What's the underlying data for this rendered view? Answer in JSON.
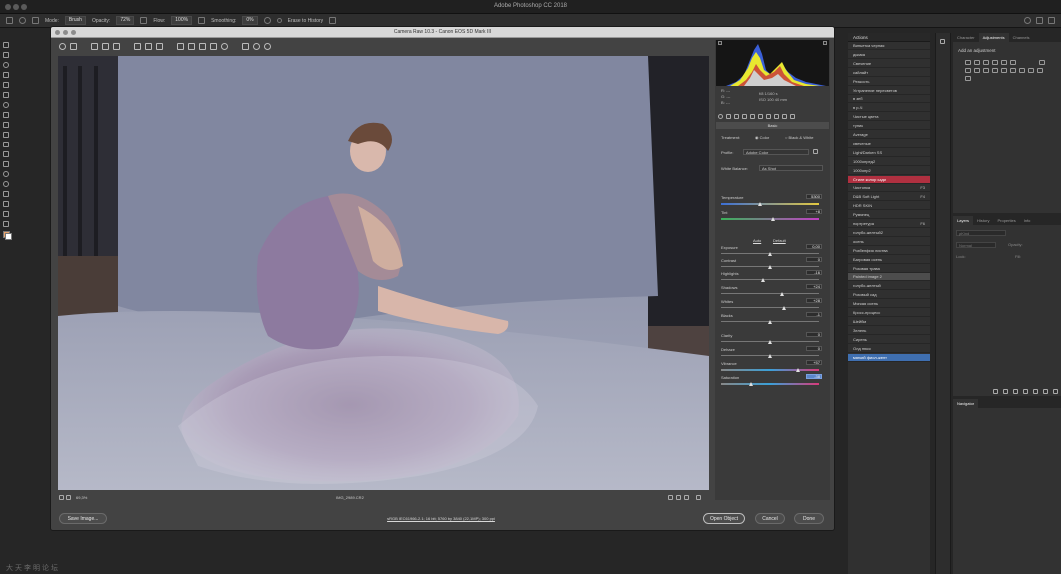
{
  "app": {
    "title": "Adobe Photoshop CC 2018"
  },
  "options_bar": {
    "mode_label": "Mode:",
    "mode_value": "Brush",
    "opacity_label": "Opacity:",
    "opacity_value": "72%",
    "flow_label": "Flow:",
    "flow_value": "100%",
    "smoothing_label": "Smoothing:",
    "smoothing_value": "0%",
    "erase_history_label": "Erase to History"
  },
  "dialog": {
    "title": "Camera Raw 10.3  -  Canon EOS 5D Mark III",
    "zoom_value": "69,3%",
    "filename": "IMG_2989.CR2",
    "workflow_info": "sRGB IEC61966-2.1; 16 bit; 5760 by 3840 (22,1MP); 300 ppi",
    "buttons": {
      "save": "Save Image...",
      "open": "Open Object",
      "cancel": "Cancel",
      "done": "Done"
    }
  },
  "histogram_readout": {
    "r_label": "R:",
    "g_label": "G:",
    "b_label": "B:",
    "dash": "---",
    "line1": "f/8   1/160 s",
    "line2": "ISO 100   40 mm"
  },
  "basic": {
    "section_title": "Basic",
    "treatment_label": "Treatment:",
    "treatment_color": "Color",
    "treatment_bw": "Black & White",
    "profile_label": "Profile:",
    "profile_value": "Adobe Color",
    "wb_label": "White Balance:",
    "wb_value": "As Shot",
    "auto_label": "Auto",
    "default_label": "Default",
    "sliders": [
      {
        "label": "Temperature",
        "value": "5300",
        "pos": 0.4
      },
      {
        "label": "Tint",
        "value": "+8",
        "pos": 0.53
      },
      {
        "label": "Exposure",
        "value": "0,00",
        "pos": 0.5
      },
      {
        "label": "Contrast",
        "value": "0",
        "pos": 0.5
      },
      {
        "label": "Highlights",
        "value": "-16",
        "pos": 0.43
      },
      {
        "label": "Shadows",
        "value": "+24",
        "pos": 0.62
      },
      {
        "label": "Whites",
        "value": "+28",
        "pos": 0.64
      },
      {
        "label": "Blacks",
        "value": "-1",
        "pos": 0.5
      },
      {
        "label": "Clarity",
        "value": "0",
        "pos": 0.5
      },
      {
        "label": "Dehaze",
        "value": "0",
        "pos": 0.5
      },
      {
        "label": "Vibrance",
        "value": "+57",
        "pos": 0.79
      },
      {
        "label": "Saturation",
        "value": "-38",
        "pos": 0.31
      }
    ]
  },
  "actions": {
    "header": "Actions",
    "items": [
      {
        "label": "Виньетка черная",
        "shortcut": ""
      },
      {
        "label": "дымка",
        "shortcut": ""
      },
      {
        "label": "Свечение",
        "shortcut": ""
      },
      {
        "label": "сайлайт",
        "shortcut": ""
      },
      {
        "label": "Резкость",
        "shortcut": ""
      },
      {
        "label": "Устранение пересветов",
        "shortcut": ""
      },
      {
        "label": "в зеб",
        "shortcut": ""
      },
      {
        "label": "в p-Ч",
        "shortcut": ""
      },
      {
        "label": "Чистые цвета",
        "shortcut": ""
      },
      {
        "label": "тупик",
        "shortcut": ""
      },
      {
        "label": "Average",
        "shortcut": ""
      },
      {
        "label": "свеченые",
        "shortcut": ""
      },
      {
        "label": "Light/Darken SS",
        "shortcut": ""
      },
      {
        "label": "1000опред2",
        "shortcut": ""
      },
      {
        "label": "1000опр2",
        "shortcut": ""
      },
      {
        "label": "Стиле колор ьзди",
        "shortcut": "",
        "state": "red"
      },
      {
        "label": "Чистопка",
        "shortcut": "F3"
      },
      {
        "label": "D&B Soft Light",
        "shortcut": "F4"
      },
      {
        "label": "HDR SKIN",
        "shortcut": ""
      },
      {
        "label": "Румянец",
        "shortcut": ""
      },
      {
        "label": "портретура",
        "shortcut": "F6"
      },
      {
        "label": "голубо-желтый2",
        "shortcut": ""
      },
      {
        "label": "осень",
        "shortcut": ""
      },
      {
        "label": "Розбелфия листва",
        "shortcut": ""
      },
      {
        "label": "Багровая осень",
        "shortcut": ""
      },
      {
        "label": "Розовая трава",
        "shortcut": ""
      },
      {
        "label": "Painted image 2",
        "shortcut": "",
        "state": "gray"
      },
      {
        "label": "голубо-желтый",
        "shortcut": ""
      },
      {
        "label": "Розовый сад",
        "shortcut": ""
      },
      {
        "label": "Мягкая осень",
        "shortcut": ""
      },
      {
        "label": "Кросс-процесс",
        "shortcut": ""
      },
      {
        "label": "Шейбм",
        "shortcut": ""
      },
      {
        "label": "Зелень",
        "shortcut": ""
      },
      {
        "label": "Сирень",
        "shortcut": ""
      },
      {
        "label": "Олд нюсс",
        "shortcut": ""
      },
      {
        "label": "мягкий фиол-желт",
        "shortcut": "",
        "state": "blue"
      }
    ]
  },
  "adjustments": {
    "tabs": [
      "Character",
      "Adjustments",
      "Channels"
    ],
    "add_label": "Add an adjustment"
  },
  "layers": {
    "tabs": [
      "Layers",
      "History",
      "Properties",
      "Info"
    ],
    "kind": "ρKind",
    "normal": "Normal",
    "opacity": "Opacity:",
    "lock": "Lock:",
    "fill": "Fill:"
  },
  "navigator": {
    "header": "Navigator"
  },
  "watermark": "大天李明论坛"
}
